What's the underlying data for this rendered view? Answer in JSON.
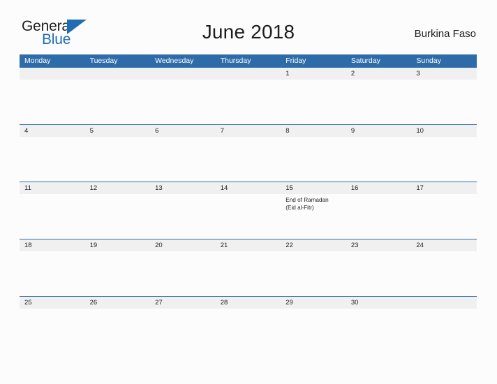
{
  "brand": {
    "name_part1": "General",
    "name_part2": "Blue",
    "flag_icon": "blue-triangle-flag-icon",
    "color_primary": "#1f6cb5",
    "color_text": "#1d1d1d"
  },
  "header": {
    "title": "June 2018",
    "country": "Burkina Faso"
  },
  "calendar": {
    "month": "June",
    "year": "2018",
    "accent_color": "#2d6ca8",
    "date_strip_color": "#f0f0f0",
    "weekdays": [
      "Monday",
      "Tuesday",
      "Wednesday",
      "Thursday",
      "Friday",
      "Saturday",
      "Sunday"
    ],
    "weeks": [
      {
        "dates": [
          "",
          "",
          "",
          "",
          "1",
          "2",
          "3"
        ],
        "events": [
          [],
          [],
          [],
          [],
          [],
          [],
          []
        ]
      },
      {
        "dates": [
          "4",
          "5",
          "6",
          "7",
          "8",
          "9",
          "10"
        ],
        "events": [
          [],
          [],
          [],
          [],
          [],
          [],
          []
        ]
      },
      {
        "dates": [
          "11",
          "12",
          "13",
          "14",
          "15",
          "16",
          "17"
        ],
        "events": [
          [],
          [],
          [],
          [],
          [
            "End of Ramadan",
            "(Eid al-Fitr)"
          ],
          [],
          []
        ]
      },
      {
        "dates": [
          "18",
          "19",
          "20",
          "21",
          "22",
          "23",
          "24"
        ],
        "events": [
          [],
          [],
          [],
          [],
          [],
          [],
          []
        ]
      },
      {
        "dates": [
          "25",
          "26",
          "27",
          "28",
          "29",
          "30",
          ""
        ],
        "events": [
          [],
          [],
          [],
          [],
          [],
          [],
          []
        ]
      }
    ]
  }
}
